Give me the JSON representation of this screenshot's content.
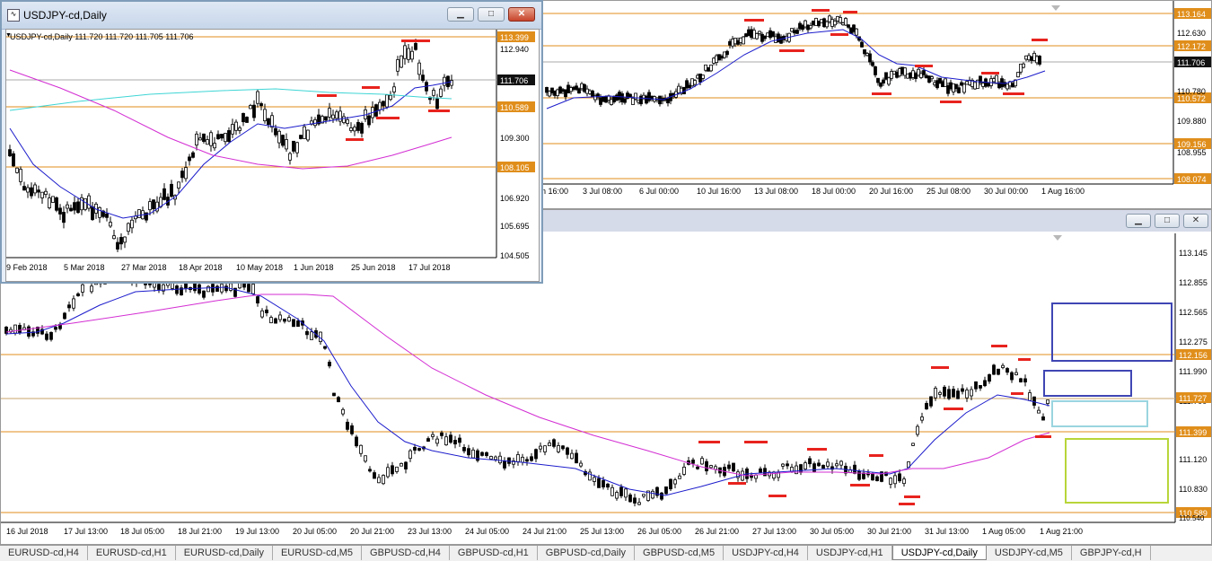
{
  "colors": {
    "bg": "#ffffff",
    "level": "#e08e1b",
    "ma_fast": "#1c1ccc",
    "ma_slow": "#d32ed3",
    "ma_cyan": "#3fd5d5",
    "marker": "#e8231e",
    "grid_gray": "#b8b8b8",
    "box_blue": "#3f46b3",
    "box_cyan": "#9ad5e0",
    "box_lime": "#b8d63a",
    "tag_orange": "#e08e1b",
    "tag_dark": "#111111"
  },
  "main_chart": {
    "price_labels": [
      "113.145",
      "112.855",
      "112.565",
      "112.275",
      "111.990",
      "111.700",
      "111.120",
      "110.830"
    ],
    "level_tags": [
      "112.156",
      "111.727",
      "111.399",
      "110.589"
    ],
    "time_labels": [
      "16 Jul 2018",
      "17 Jul 13:00",
      "18 Jul 05:00",
      "18 Jul 21:00",
      "19 Jul 13:00",
      "20 Jul 05:00",
      "20 Jul 21:00",
      "23 Jul 13:00",
      "24 Jul 05:00",
      "24 Jul 21:00",
      "25 Jul 13:00",
      "26 Jul 05:00",
      "26 Jul 21:00",
      "27 Jul 13:00",
      "30 Jul 05:00",
      "30 Jul 21:00",
      "31 Jul 13:00",
      "1 Aug 05:00",
      "1 Aug 21:00"
    ],
    "bottom_tag": "110.540",
    "window_icons": {
      "minimize": "minimize-icon",
      "maximize": "maximize-icon",
      "close": "close-icon"
    }
  },
  "h4_chart": {
    "price_labels": [
      "112.630",
      "110.780",
      "109.880",
      "108.955"
    ],
    "level_tags": [
      "113.164",
      "112.172",
      "111.706",
      "110.572",
      "109.156",
      "108.074"
    ],
    "time_labels": [
      "n 16:00",
      "3 Jul 08:00",
      "6 Jul 00:00",
      "10 Jul 16:00",
      "13 Jul 08:00",
      "18 Jul 00:00",
      "20 Jul 16:00",
      "25 Jul 08:00",
      "30 Jul 00:00",
      "1 Aug 16:00"
    ]
  },
  "daily_window": {
    "title": "USDJPY-cd,Daily",
    "info": "USDJPY-cd,Daily  111.720 111.720 111.705 111.706",
    "price_labels": [
      "112.940",
      "109.300",
      "106.920",
      "105.695",
      "104.505"
    ],
    "level_tags": [
      "113.399",
      "111.706",
      "110.589",
      "108.105"
    ],
    "time_labels": [
      "9 Feb 2018",
      "5 Mar 2018",
      "27 Mar 2018",
      "18 Apr 2018",
      "10 May 2018",
      "1 Jun 2018",
      "25 Jun 2018",
      "17 Jul 2018"
    ],
    "buttons": {
      "minimize": "▁",
      "maximize": "□",
      "close": "✕"
    }
  },
  "tabs": [
    "EURUSD-cd,H4",
    "EURUSD-cd,H1",
    "EURUSD-cd,Daily",
    "EURUSD-cd,M5",
    "GBPUSD-cd,H4",
    "GBPUSD-cd,H1",
    "GBPUSD-cd,Daily",
    "GBPUSD-cd,M5",
    "USDJPY-cd,H4",
    "USDJPY-cd,H1",
    "USDJPY-cd,Daily",
    "USDJPY-cd,M5",
    "GBPJPY-cd,H"
  ],
  "active_tab": "USDJPY-cd,Daily"
}
